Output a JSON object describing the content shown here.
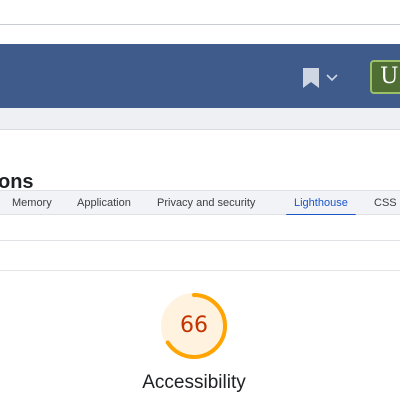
{
  "header": {
    "avatar_letter": "U",
    "bookmark_icon": "bookmark-icon",
    "menu_icon": "chevron-down-icon",
    "colors": {
      "bar": "#3f5b8c",
      "avatar_bg": "#4e6e33",
      "avatar_border": "#9bc068"
    }
  },
  "panel": {
    "title": "ons"
  },
  "tabs": [
    {
      "label": "Memory",
      "active": false
    },
    {
      "label": "Application",
      "active": false
    },
    {
      "label": "Privacy and security",
      "active": false
    },
    {
      "label": "Lighthouse",
      "active": true
    },
    {
      "label": "CSS c",
      "active": false
    }
  ],
  "score": {
    "value": "66",
    "fraction": 0.66,
    "label": "Accessibility",
    "color": "#ffa400",
    "track_color": "#fff3e0",
    "text_color": "#c33300"
  }
}
